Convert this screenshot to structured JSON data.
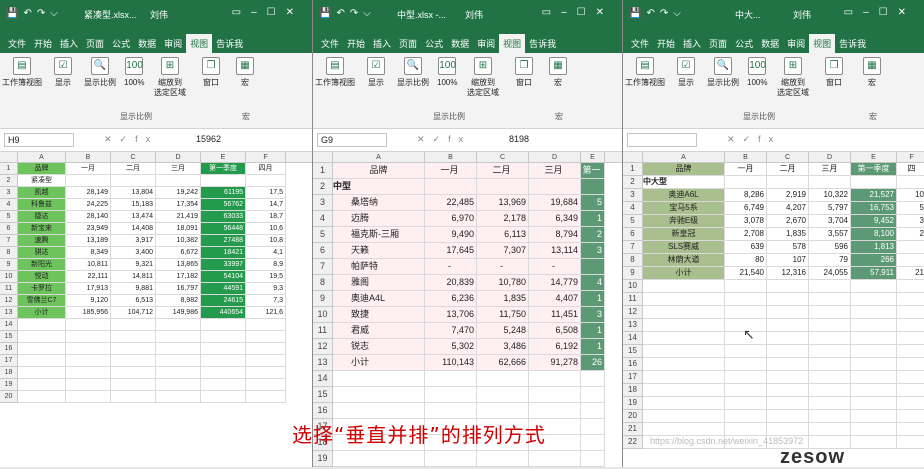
{
  "windows": [
    {
      "title": "紧凑型.xlsx...",
      "user": "刘伟",
      "cell_ref": "H9",
      "formula_value": "15962"
    },
    {
      "title": "中型.xlsx -...",
      "user": "刘伟",
      "cell_ref": "G9",
      "formula_value": "8198"
    },
    {
      "title": "中大...",
      "user": "刘伟",
      "cell_ref": "",
      "formula_value": ""
    }
  ],
  "tabs": [
    "文件",
    "开始",
    "插入",
    "页面",
    "公式",
    "数据",
    "审阅",
    "视图",
    "告诉我"
  ],
  "ribbon": {
    "workbook_view": "工作簿视图",
    "show": "显示",
    "zoom": "显示比例",
    "zoom100": "100%",
    "zoom_sel": "缩放到\n选定区域",
    "zoom_group": "显示比例",
    "window": "窗口",
    "macro": "宏",
    "macro_group": "宏"
  },
  "colors": {
    "title_bar": "#217346",
    "green_header": "#6dc45c",
    "dark_green": "#239a4c",
    "pink": "#fdeff2",
    "olive": "#a9c08e",
    "teal": "#5b9a74"
  },
  "w1": {
    "cols": [
      "A",
      "B",
      "C",
      "D",
      "E",
      "F"
    ],
    "rows": [
      [
        "品牌",
        "一月",
        "二月",
        "三月",
        "第一季度",
        "四月"
      ],
      [
        "紧凑型",
        "",
        "",
        "",
        "",
        ""
      ],
      [
        "凯越",
        "28,149",
        "13,804",
        "19,242",
        "61195",
        "17,5"
      ],
      [
        "科鲁兹",
        "24,225",
        "15,183",
        "17,354",
        "56762",
        "14,7"
      ],
      [
        "捷达",
        "28,140",
        "13,474",
        "21,419",
        "63033",
        "18,7"
      ],
      [
        "新宝来",
        "23,949",
        "14,408",
        "18,091",
        "56448",
        "10,6"
      ],
      [
        "速腾",
        "13,189",
        "3,917",
        "10,382",
        "27488",
        "10,8"
      ],
      [
        "骐达",
        "8,349",
        "3,400",
        "6,672",
        "18421",
        "4,1"
      ],
      [
        "新阳光",
        "10,811",
        "9,321",
        "13,865",
        "33997",
        "8,9"
      ],
      [
        "悦动",
        "22,111",
        "14,811",
        "17,182",
        "54104",
        "19,5"
      ],
      [
        "卡罗拉",
        "17,913",
        "9,881",
        "16,797",
        "44591",
        "9,3"
      ],
      [
        "雪佛兰C7",
        "9,120",
        "6,513",
        "8,982",
        "24615",
        "7,3"
      ],
      [
        "小计",
        "185,956",
        "104,712",
        "149,986",
        "440654",
        "121,6"
      ]
    ]
  },
  "w2": {
    "cols": [
      "A",
      "B",
      "C",
      "D",
      "E"
    ],
    "rows": [
      [
        "品牌",
        "一月",
        "二月",
        "三月",
        "第一"
      ],
      [
        "中型",
        "",
        "",
        "",
        ""
      ],
      [
        "桑塔纳",
        "22,485",
        "13,969",
        "19,684",
        "5"
      ],
      [
        "迈腾",
        "6,970",
        "2,178",
        "6,349",
        "1"
      ],
      [
        "福克斯-三厢",
        "9,490",
        "6,113",
        "8,794",
        "2"
      ],
      [
        "天籁",
        "17,645",
        "7,307",
        "13,114",
        "3"
      ],
      [
        "帕萨特",
        "-",
        "-",
        "-",
        ""
      ],
      [
        "雅阁",
        "20,839",
        "10,780",
        "14,779",
        "4"
      ],
      [
        "奥迪A4L",
        "6,236",
        "1,835",
        "4,407",
        "1"
      ],
      [
        "致捷",
        "13,706",
        "11,750",
        "11,451",
        "3"
      ],
      [
        "君威",
        "7,470",
        "5,248",
        "6,508",
        "1"
      ],
      [
        "锐志",
        "5,302",
        "3,486",
        "6,192",
        "1"
      ],
      [
        "小计",
        "110,143",
        "62,666",
        "91,278",
        "26"
      ]
    ]
  },
  "w3": {
    "cols": [
      "A",
      "B",
      "C",
      "D",
      "E",
      "F"
    ],
    "rows": [
      [
        "品牌",
        "一月",
        "二月",
        "三月",
        "第一季度",
        "四"
      ],
      [
        "中大型",
        "",
        "",
        "",
        "",
        ""
      ],
      [
        "奥迪A6L",
        "8,286",
        "2,919",
        "10,322",
        "21,527",
        "10"
      ],
      [
        "宝马5系",
        "6,749",
        "4,207",
        "5,797",
        "16,753",
        "5"
      ],
      [
        "奔驰E级",
        "3,078",
        "2,670",
        "3,704",
        "9,452",
        "3"
      ],
      [
        "新皇冠",
        "2,708",
        "1,835",
        "3,557",
        "8,100",
        "2"
      ],
      [
        "SLS赛威",
        "639",
        "578",
        "596",
        "1,813",
        ""
      ],
      [
        "林荫大道",
        "80",
        "107",
        "79",
        "266",
        ""
      ],
      [
        "小计",
        "21,540",
        "12,316",
        "24,055",
        "57,911",
        "21"
      ]
    ]
  },
  "caption": "选择“垂直并排”的排列方式",
  "watermark": "zesow",
  "watermark_url": "https://blog.csdn.net/weixin_41853972"
}
